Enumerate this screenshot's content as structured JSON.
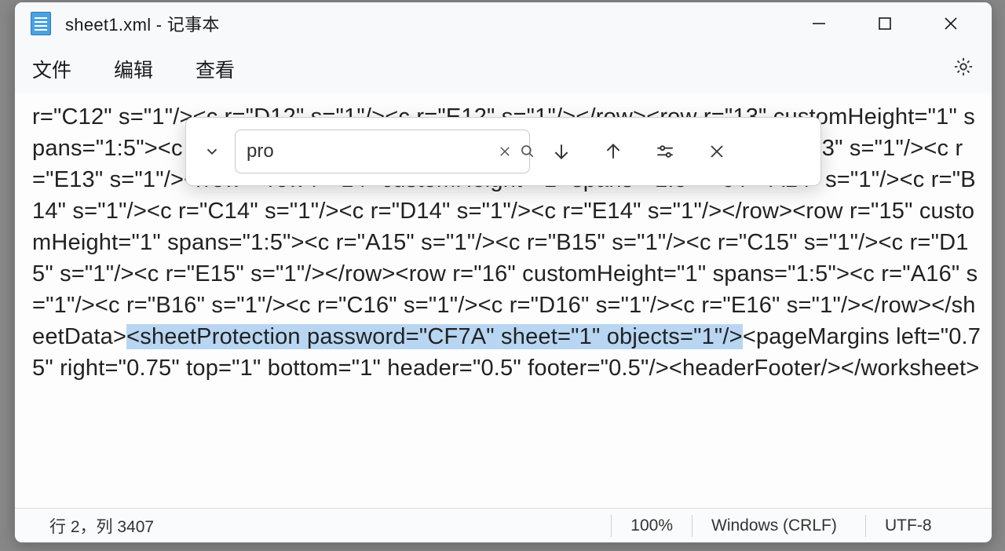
{
  "window": {
    "title": "sheet1.xml - 记事本"
  },
  "menu": {
    "file": "文件",
    "edit": "编辑",
    "view": "查看"
  },
  "find": {
    "value": "pro"
  },
  "content": {
    "pre": "r=\"C12\" s=\"1\"/><c r=\"D12\" s=\"1\"/><c r=\"E12\" s=\"1\"/></row><row r=\"13\" customHeight=\"1\" spans=\"1:5\"><c r=\"A13\" s=\"1\"/><c r=\"B13\" s=\"1\"/><c r=\"C13\" s=\"1\"/><c r=\"D13\" s=\"1\"/><c r=\"E13\" s=\"1\"/></row><row r=\"14\" customHeight=\"1\" spans=\"1:5\"><c r=\"A14\" s=\"1\"/><c r=\"B14\" s=\"1\"/><c r=\"C14\" s=\"1\"/><c r=\"D14\" s=\"1\"/><c r=\"E14\" s=\"1\"/></row><row r=\"15\" customHeight=\"1\" spans=\"1:5\"><c r=\"A15\" s=\"1\"/><c r=\"B15\" s=\"1\"/><c r=\"C15\" s=\"1\"/><c r=\"D15\" s=\"1\"/><c r=\"E15\" s=\"1\"/></row><row r=\"16\" customHeight=\"1\" spans=\"1:5\"><c r=\"A16\" s=\"1\"/><c r=\"B16\" s=\"1\"/><c r=\"C16\" s=\"1\"/><c r=\"D16\" s=\"1\"/><c r=\"E16\" s=\"1\"/></row></sheetData>",
    "highlight": "<sheetProtection password=\"CF7A\" sheet=\"1\" objects=\"1\"/>",
    "post": "<pageMargins left=\"0.75\" right=\"0.75\" top=\"1\" bottom=\"1\" header=\"0.5\" footer=\"0.5\"/><headerFooter/></worksheet>"
  },
  "status": {
    "position": "行 2，列 3407",
    "zoom": "100%",
    "lineending": "Windows (CRLF)",
    "encoding": "UTF-8"
  }
}
